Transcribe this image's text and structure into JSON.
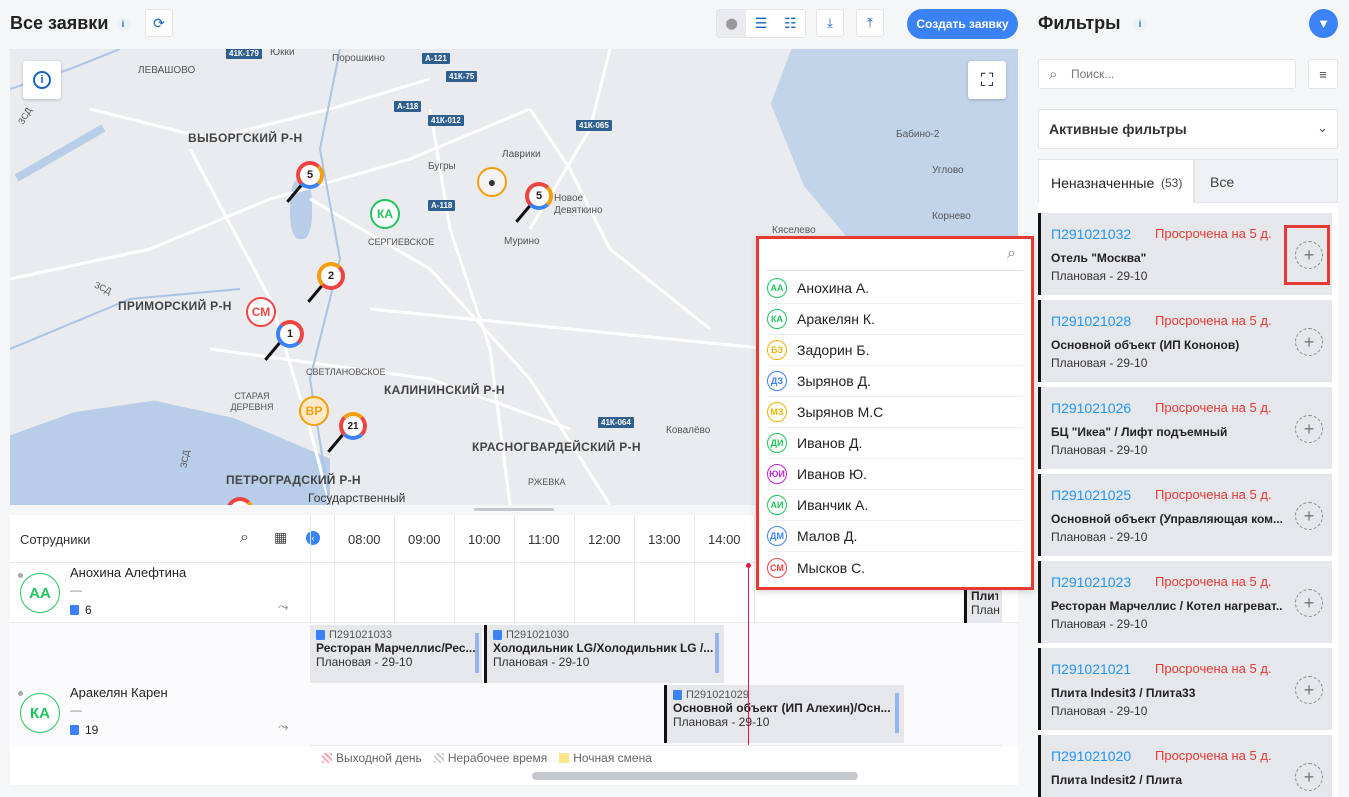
{
  "header": {
    "title": "Все заявки",
    "create_button": "Создать заявку"
  },
  "filters": {
    "title": "Фильтры",
    "search_placeholder": "Поиск...",
    "active_filters": "Активные фильтры",
    "tabs": [
      {
        "label": "Неназначенные",
        "count": "(53)"
      },
      {
        "label": "Все"
      }
    ]
  },
  "map": {
    "districts": [
      "ВЫБОРГСКИЙ Р-Н",
      "ПРИМОРСКИЙ Р-Н",
      "КАЛИНИНСКИЙ Р-Н",
      "КРАСНОГВАРДЕЙСКИЙ Р-Н",
      "ПЕТРОГРАДСКИЙ Р-Н"
    ],
    "places": [
      "Юкки",
      "Порошкино",
      "ЛЕВАШОВО",
      "Бабино-2",
      "Лаврики",
      "Бугры",
      "Новое Девяткино",
      "Мурино",
      "Углово",
      "Корнево",
      "Кяселево",
      "Сергиевское",
      "Светлановское",
      "Старая деревня",
      "Ковалёво",
      "Ржевка",
      "Государственный"
    ],
    "roads": [
      "41К-179",
      "А-121",
      "41К-75",
      "А-118",
      "41К-012",
      "41К-065",
      "А-118",
      "41К-064",
      "ЗСД",
      "ЗСД",
      "ЗСД"
    ],
    "clusters": [
      "5",
      "5",
      "2",
      "1",
      "21"
    ],
    "avatars": [
      {
        "initials": "КА",
        "color": "#22c55e"
      },
      {
        "initials": "СМ",
        "color": "#ef4444"
      },
      {
        "initials": "ВР",
        "color": "#f59e0b"
      }
    ]
  },
  "timeline": {
    "employees_label": "Сотрудники",
    "hours": [
      "08:00",
      "09:00",
      "10:00",
      "11:00",
      "12:00",
      "13:00",
      "14:00"
    ],
    "employees": [
      {
        "initials": "АА",
        "name": "Анохина Алефтина",
        "dash": "—",
        "count": "6"
      },
      {
        "initials": "КА",
        "name": "Аракелян Карен",
        "dash": "—",
        "count": "19"
      }
    ],
    "tasks": [
      {
        "num": "П291021033",
        "title": "Ресторан Марчеллис/Рес...",
        "sub": "Плановая - 29-10"
      },
      {
        "num": "П291021030",
        "title": "Холодильник LG/Холодильник LG /...",
        "sub": "Плановая - 29-10"
      },
      {
        "num": "П291021029",
        "title": "Основной объект (ИП Алехин)/Осн...",
        "sub": "Плановая - 29-10"
      }
    ],
    "partial_task": {
      "line1": "Плит",
      "line2": "План"
    },
    "legend": [
      "Выходной день",
      "Нерабочее время",
      "Ночная смена"
    ]
  },
  "dropdown": {
    "items": [
      {
        "initials": "АА",
        "name": "Анохина А.",
        "color": "#22c55e"
      },
      {
        "initials": "КА",
        "name": "Аракелян К.",
        "color": "#22c55e"
      },
      {
        "initials": "БЗ",
        "name": "Задорин Б.",
        "color": "#eab308"
      },
      {
        "initials": "ДЗ",
        "name": "Зырянов Д.",
        "color": "#3b82f6"
      },
      {
        "initials": "МЗ",
        "name": "Зырянов М.С",
        "color": "#eab308"
      },
      {
        "initials": "ДИ",
        "name": "Иванов Д.",
        "color": "#22c55e"
      },
      {
        "initials": "ЮИ",
        "name": "Иванов Ю.",
        "color": "#c026d3"
      },
      {
        "initials": "АИ",
        "name": "Иванчик А.",
        "color": "#22c55e"
      },
      {
        "initials": "ДМ",
        "name": "Малов Д.",
        "color": "#3b82f6"
      },
      {
        "initials": "СМ",
        "name": "Мысков С.",
        "color": "#ef4444"
      }
    ]
  },
  "requests": [
    {
      "num": "П291021032",
      "late": "Просрочена на 5 д.",
      "title": "Отель \"Москва\"",
      "sub": "Плановая - 29-10"
    },
    {
      "num": "П291021028",
      "late": "Просрочена на 5 д.",
      "title": "Основной объект (ИП Кононов)",
      "sub": "Плановая - 29-10"
    },
    {
      "num": "П291021026",
      "late": "Просрочена на 5 д.",
      "title": "БЦ \"Икеа\" / Лифт подъемный",
      "sub": "Плановая - 29-10"
    },
    {
      "num": "П291021025",
      "late": "Просрочена на 5 д.",
      "title": "Основной объект (Управляющая ком...",
      "sub": "Плановая - 29-10"
    },
    {
      "num": "П291021023",
      "late": "Просрочена на 5 д.",
      "title": "Ресторан Марчеллис / Котел нагреват...",
      "sub": "Плановая - 29-10"
    },
    {
      "num": "П291021021",
      "late": "Просрочена на 5 д.",
      "title": "Плита Indesit3 / Плита33",
      "sub": "Плановая - 29-10"
    },
    {
      "num": "П291021020",
      "late": "Просрочена на 5 д.",
      "title": "Плита Indesit2 / Плита",
      "sub": ""
    }
  ],
  "colors": {
    "accent": "#3b82f6",
    "late": "#e53935",
    "highlight": "#e53935"
  }
}
